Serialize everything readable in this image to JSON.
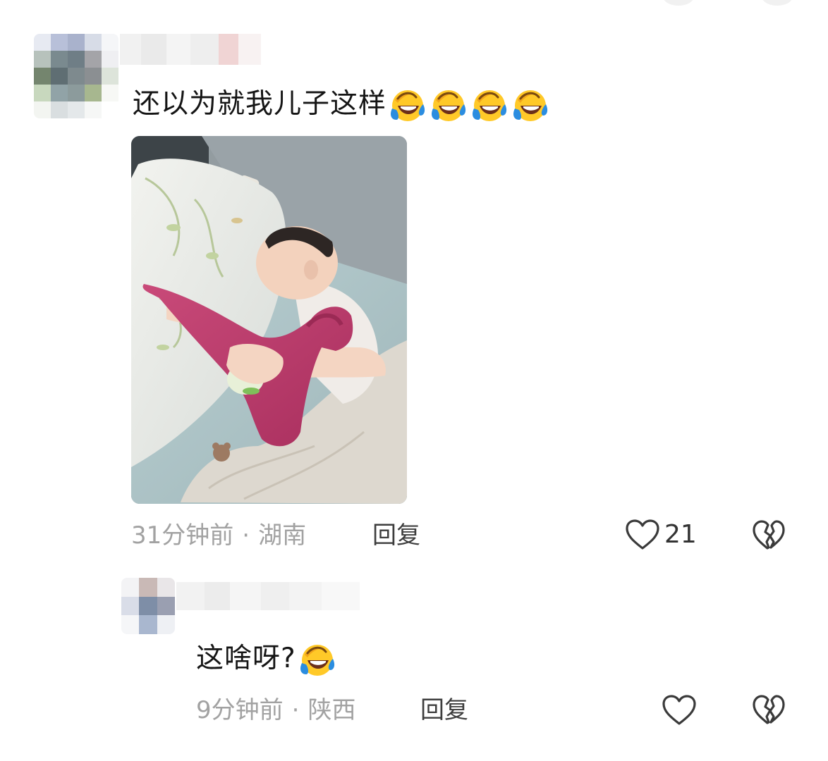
{
  "comments": [
    {
      "text": "还以为就我儿子这样",
      "emoji": "laughing-crying-emoji",
      "emoji_count": 4,
      "time": "31分钟前",
      "separator": "·",
      "location": "湖南",
      "reply_label": "回复",
      "likes": "21",
      "has_image": true
    },
    {
      "text": "这啥呀?",
      "emoji": "laughing-crying-emoji",
      "emoji_count": 1,
      "time": "9分钟前",
      "separator": "·",
      "location": "陕西",
      "reply_label": "回复",
      "likes": "",
      "has_image": false
    }
  ],
  "icons": {
    "like": "heart-outline-icon",
    "dislike": "broken-heart-icon"
  },
  "colors": {
    "meta_text": "#a2a2a2",
    "reply_text": "#3d3d3d",
    "icon_stroke": "#3a3a3a",
    "emoji_yellow": "#ffc928",
    "tear_blue": "#2b8de0"
  }
}
